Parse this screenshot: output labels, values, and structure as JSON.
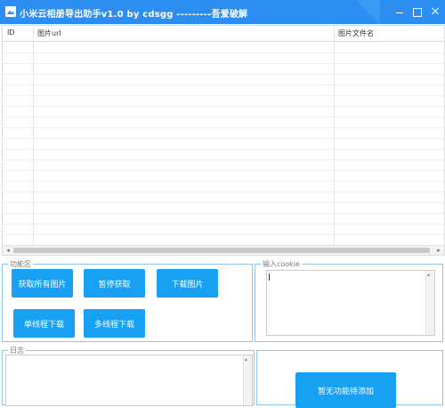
{
  "window": {
    "title": "小米云相册导出助手v1.0 by cdsgg ---------吾爱破解"
  },
  "table": {
    "columns": [
      "ID",
      "图片url",
      "图片文件名"
    ],
    "rows": []
  },
  "function_area": {
    "label": "功能区",
    "buttons": {
      "get_all": "获取所有图片",
      "pause": "暂停获取",
      "download": "下载图片",
      "single_thread": "单线程下载",
      "multi_thread": "多线程下载"
    }
  },
  "cookie": {
    "label": "输入cookie",
    "value": ""
  },
  "log": {
    "label": "日志",
    "value": ""
  },
  "extra": {
    "button": "暂无功能待添加"
  },
  "colors": {
    "titlebar": "#2b8ef0",
    "button": "#18a0f2",
    "group_border": "#8fc4ef"
  }
}
